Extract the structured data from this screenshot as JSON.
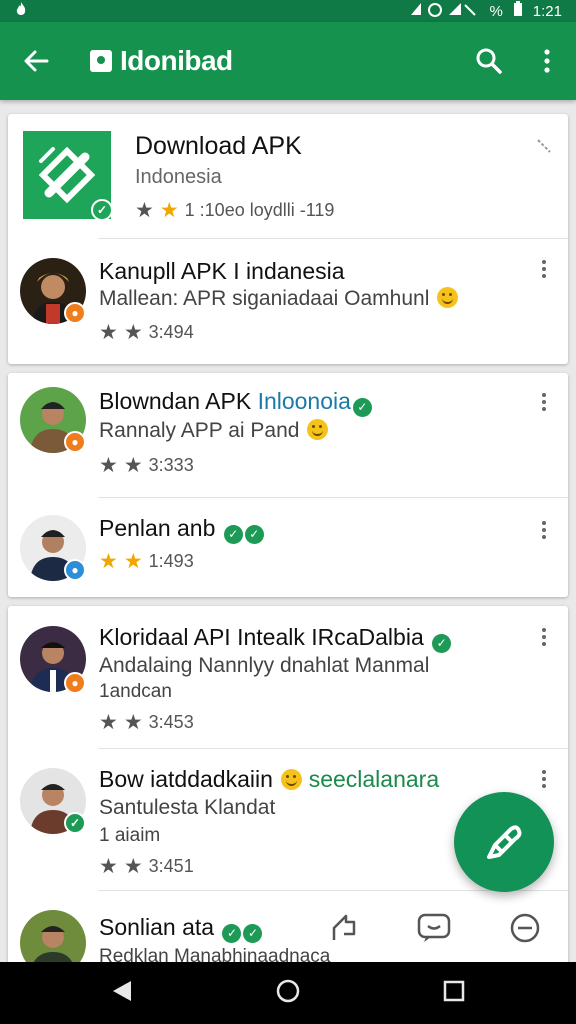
{
  "status_bar": {
    "left_icon": "flame-icon",
    "battery": "%",
    "time": "1:21"
  },
  "app_bar": {
    "title": "Idonibad",
    "back_icon": "arrow-left-icon",
    "search_icon": "search-icon",
    "menu_icon": "overflow-menu-icon"
  },
  "hero": {
    "title": "Download APK",
    "subtitle": "Indonesia",
    "meta": "1 :10eo loydlli -119"
  },
  "rows": [
    {
      "title": "Kanupll APK I indanesia",
      "sub": "Mallean: APR siganiadaai Oamhunl",
      "meta": "3:494"
    },
    {
      "title_a": "Blowndan APK ",
      "title_b": "Inloonoia",
      "sub": "Rannaly APP ai Pand",
      "meta": "3:333"
    },
    {
      "title": "Penlan anb",
      "meta": "1:493"
    },
    {
      "title": "Kloridaal API Intealk IRcaDalbia",
      "sub": "Andalaing  Nannlyy dnahlat  Manmal",
      "sub2": "1andcan",
      "meta": "3:453"
    },
    {
      "title_a": "Bow iatddadkaiin ",
      "title_b": "seeclalanara",
      "sub": "Santulesta  Klandat",
      "sub2": "1 aiaim",
      "meta": "3:451"
    },
    {
      "title": "Sonlian ata",
      "sub": "Redklan Manabhinaadnaca"
    }
  ],
  "nav": {
    "back": "back-icon",
    "home": "home-icon",
    "recents": "recents-icon"
  },
  "colors": {
    "primary": "#16924f",
    "status": "#0f7a45",
    "star": "#f2a600"
  }
}
